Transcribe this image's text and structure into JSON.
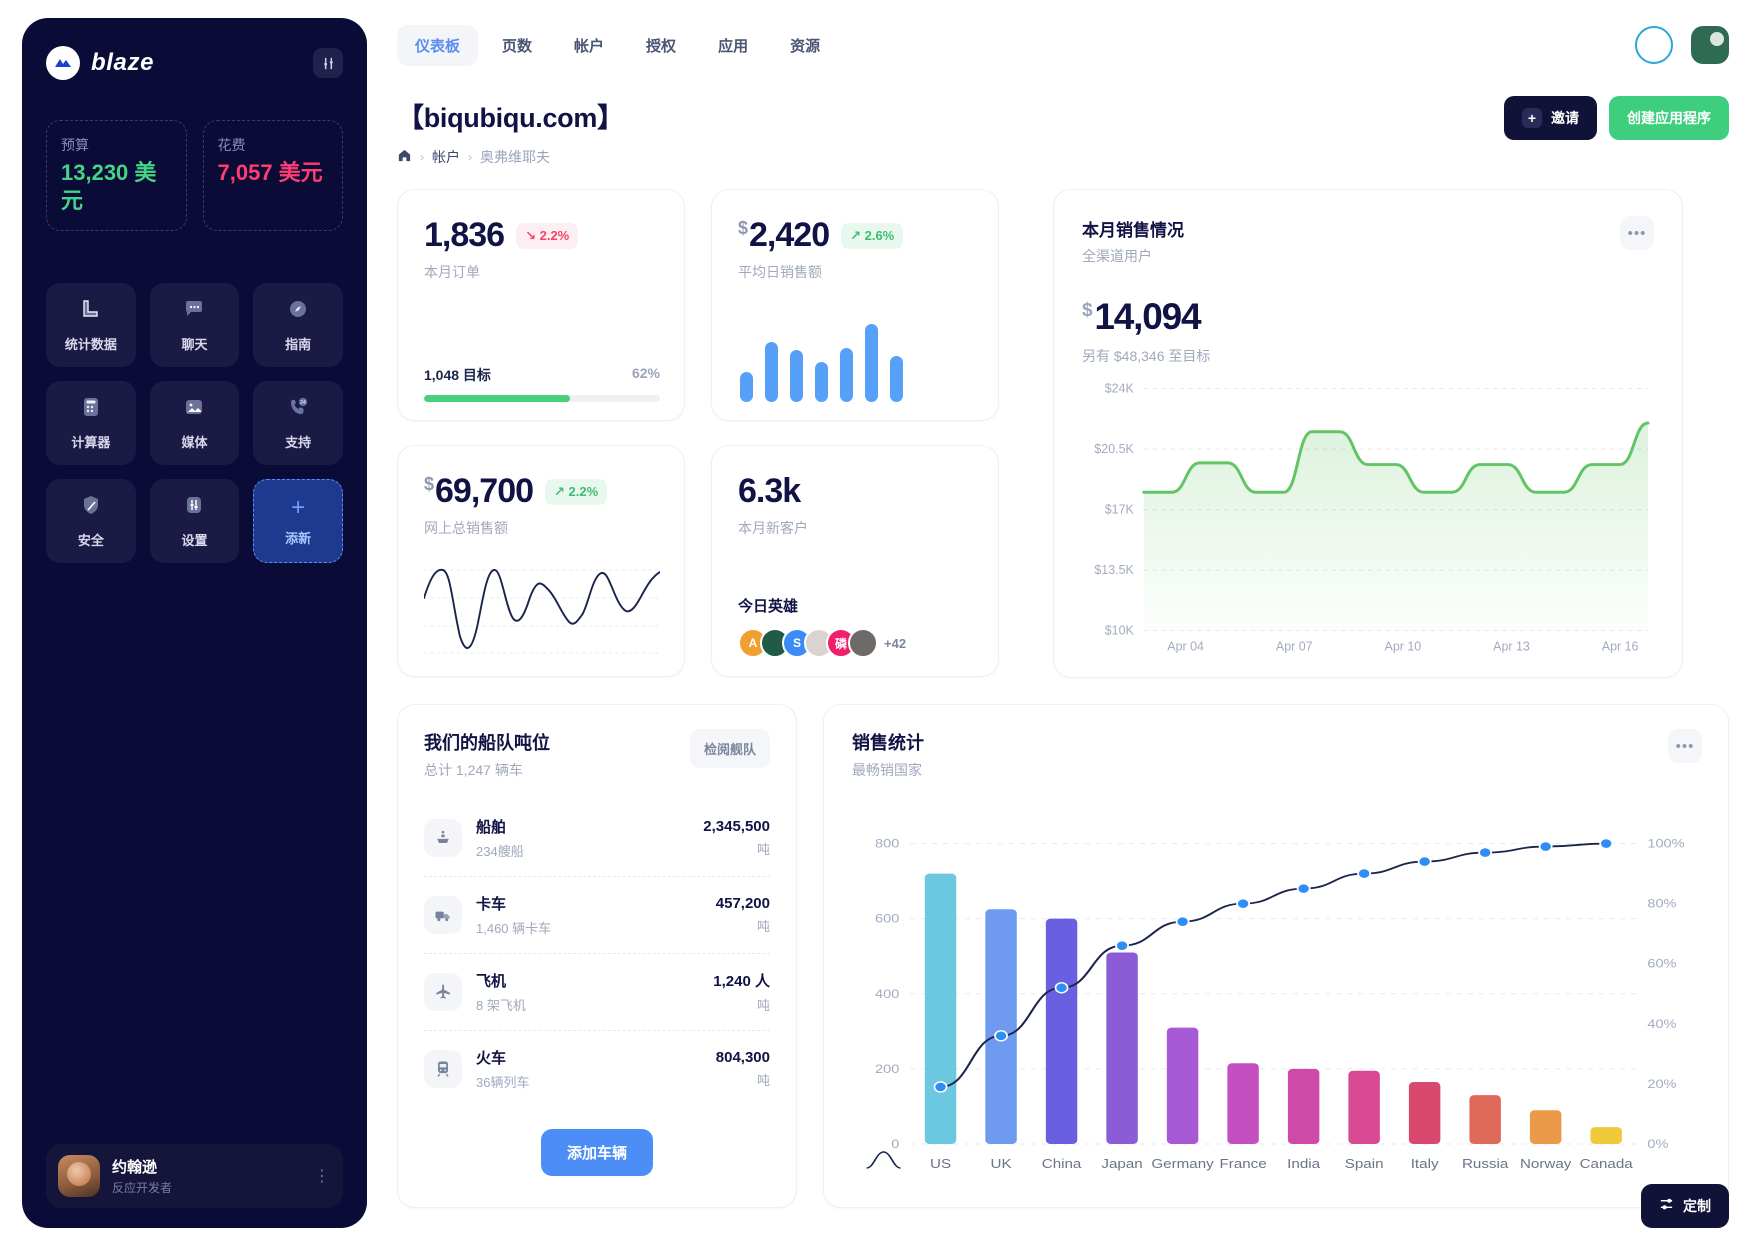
{
  "sidebar": {
    "brand": "blaze",
    "brand_icon": "blaze-logo-icon",
    "settings_icon": "sliders-icon",
    "money": [
      {
        "label": "预算",
        "value": "13,230 美元",
        "tone": "green"
      },
      {
        "label": "花费",
        "value": "7,057 美元",
        "tone": "pink"
      }
    ],
    "tiles": [
      {
        "label": "统计数据",
        "icon": "bar-chart-icon"
      },
      {
        "label": "聊天",
        "icon": "chat-bubble-icon"
      },
      {
        "label": "指南",
        "icon": "compass-icon"
      },
      {
        "label": "计算器",
        "icon": "calculator-icon"
      },
      {
        "label": "媒体",
        "icon": "image-icon"
      },
      {
        "label": "支持",
        "icon": "support-24-icon"
      },
      {
        "label": "安全",
        "icon": "shield-icon"
      },
      {
        "label": "设置",
        "icon": "sliders-icon"
      },
      {
        "label": "添新",
        "icon": "plus-icon"
      }
    ],
    "profile": {
      "name": "约翰逊",
      "role": "反应开发者",
      "menu_icon": "dots-vertical-icon"
    }
  },
  "topbar": {
    "tabs": [
      {
        "label": "仪表板",
        "active": true
      },
      {
        "label": "页数",
        "active": false
      },
      {
        "label": "帐户",
        "active": false
      },
      {
        "label": "授权",
        "active": false
      },
      {
        "label": "应用",
        "active": false
      },
      {
        "label": "资源",
        "active": false
      }
    ],
    "ring_icon": "loading-ring-icon",
    "avatar_icon": "user-avatar"
  },
  "page": {
    "title": "【biqubiqu.com】",
    "breadcrumb": {
      "home_icon": "home-icon",
      "items": [
        "帐户",
        "奥弗维耶夫"
      ]
    },
    "invite_label": "邀请",
    "create_app_label": "创建应用程序"
  },
  "kpis": {
    "orders": {
      "value": "1,836",
      "delta": "↘ 2.2%",
      "delta_dir": "down",
      "label": "本月订单",
      "goal_label": "1,048 目标",
      "goal_pct": "62%",
      "goal_fill": 62
    },
    "avg_sale": {
      "currency": "$",
      "value": "2,420",
      "delta": "↗ 2.6%",
      "delta_dir": "up",
      "label": "平均日销售额",
      "bars": [
        30,
        60,
        52,
        40,
        54,
        78,
        46
      ]
    },
    "online_sales": {
      "currency": "$",
      "value": "69,700",
      "delta": "↗ 2.2%",
      "delta_dir": "up",
      "label": "网上总销售额"
    },
    "new_customers": {
      "value": "6.3k",
      "label": "本月新客户",
      "heroes_title": "今日英雄",
      "heroes": [
        {
          "initial": "A",
          "color": "#f0a030"
        },
        {
          "initial": "",
          "color": "#1f5b47"
        },
        {
          "initial": "S",
          "color": "#3d8bf7"
        },
        {
          "initial": "",
          "color": "#d9d4d0"
        },
        {
          "initial": "磷",
          "color": "#ef1f6b"
        },
        {
          "initial": "",
          "color": "#6d6a68"
        }
      ],
      "more": "+42"
    }
  },
  "sales_card": {
    "title": "本月销售情况",
    "subtitle": "全渠道用户",
    "currency": "$",
    "amount": "14,094",
    "to_goal": "另有 $48,346 至目标",
    "menu_icon": "dots-horizontal-icon"
  },
  "fleet": {
    "title": "我们的船队吨位",
    "subtitle": "总计 1,247 辆车",
    "action_label": "检阅舰队",
    "add_label": "添加车辆",
    "rows": [
      {
        "icon": "ship-icon",
        "name": "船舶",
        "meta": "234艘船",
        "value": "2,345,500",
        "unit": "吨"
      },
      {
        "icon": "truck-icon",
        "name": "卡车",
        "meta": "1,460 辆卡车",
        "value": "457,200",
        "unit": "吨"
      },
      {
        "icon": "plane-icon",
        "name": "飞机",
        "meta": "8 架飞机",
        "value": "1,240 人",
        "unit": "吨"
      },
      {
        "icon": "train-icon",
        "name": "火车",
        "meta": "36辆列车",
        "value": "804,300",
        "unit": "吨"
      }
    ]
  },
  "stats_card": {
    "title": "销售统计",
    "subtitle": "最畅销国家",
    "menu_icon": "dots-horizontal-icon",
    "footer_icon": "sparkline-icon"
  },
  "footer": {
    "customize_label": "定制",
    "customize_icon": "sliders-icon"
  },
  "colors": {
    "sidebar_bg": "#0b0b38",
    "accent_blue": "#4d8df6",
    "accent_green": "#3ecf7e",
    "danger": "#f2456b"
  },
  "chart_data": [
    {
      "id": "monthly-sales-area",
      "type": "area",
      "title": "本月销售情况",
      "subtitle": "全渠道用户",
      "ylabel": "",
      "xlabel": "",
      "ytick_labels": [
        "$24K",
        "$20.5K",
        "$17K",
        "$13.5K",
        "$10K"
      ],
      "ylim": [
        10000,
        24000
      ],
      "xtick_labels": [
        "Apr 04",
        "Apr 07",
        "Apr 10",
        "Apr 13",
        "Apr 16"
      ],
      "grid": true,
      "legend": "none",
      "line_color": "#63c466",
      "x": [
        0,
        1,
        2,
        3,
        4,
        5,
        6,
        7,
        8,
        9,
        10,
        11,
        12,
        13,
        14,
        15,
        16,
        17,
        18
      ],
      "values": [
        18000,
        18000,
        19700,
        19700,
        18000,
        18000,
        21500,
        21500,
        19600,
        19600,
        18000,
        18000,
        19600,
        19600,
        18000,
        18000,
        19600,
        19600,
        22000
      ]
    },
    {
      "id": "sales-statistics-pareto",
      "type": "bar",
      "title": "销售统计",
      "subtitle": "最畅销国家",
      "categories": [
        "US",
        "UK",
        "China",
        "Japan",
        "Germany",
        "France",
        "India",
        "Spain",
        "Italy",
        "Russia",
        "Norway",
        "Canada"
      ],
      "values": [
        720,
        625,
        600,
        510,
        310,
        215,
        200,
        195,
        165,
        130,
        90,
        45
      ],
      "ylabel": "",
      "ylim": [
        0,
        900
      ],
      "ytick_labels": [
        "0",
        "200",
        "400",
        "600",
        "800"
      ],
      "y2_label": "",
      "y2lim": [
        0,
        100
      ],
      "y2tick_labels": [
        "0%",
        "20%",
        "40%",
        "60%",
        "80%",
        "100%"
      ],
      "cumulative_pct": [
        19,
        36,
        52,
        66,
        74,
        80,
        85,
        90,
        94,
        97,
        99,
        100
      ],
      "bar_colors": [
        "#6cc7e0",
        "#6e9bf0",
        "#6a5fe0",
        "#8b5cd6",
        "#a85ad6",
        "#c44fc0",
        "#cf4aa6",
        "#d74a93",
        "#d9496f",
        "#e06a5a",
        "#eb9a4a",
        "#f0c93c"
      ],
      "line_color": "#1b254b",
      "marker_color": "#2f8ef5",
      "grid": true,
      "legend": "none"
    }
  ]
}
